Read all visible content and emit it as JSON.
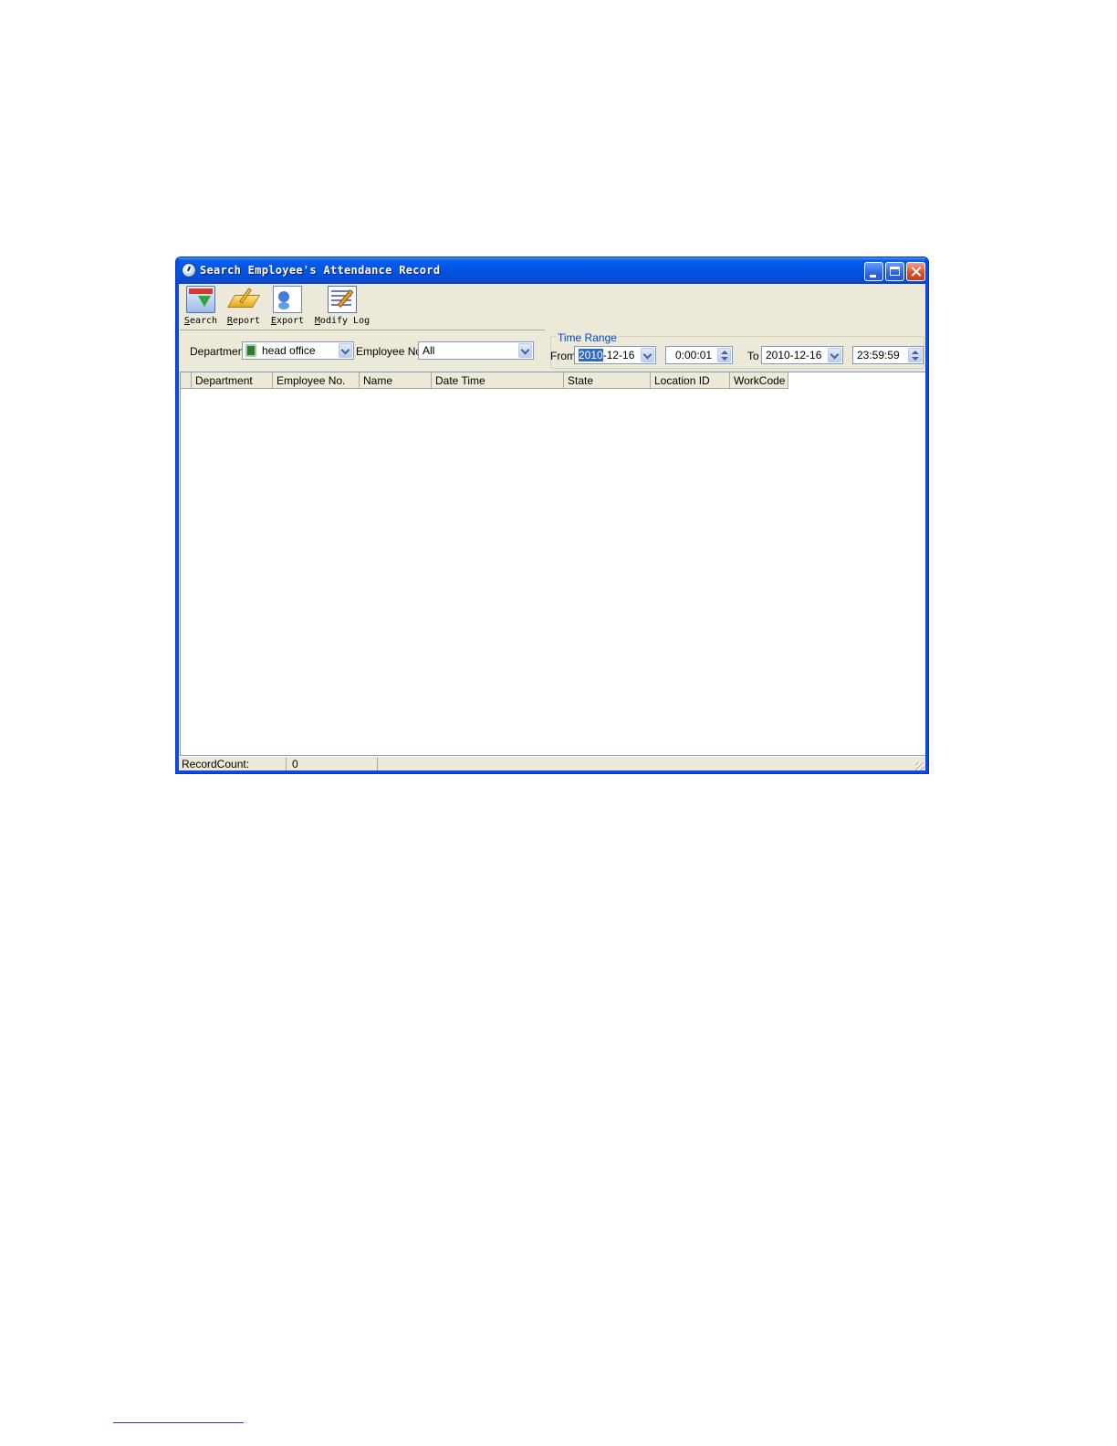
{
  "window": {
    "title": "Search Employee's Attendance Record"
  },
  "toolbar": {
    "search_label": "Search",
    "report_label": "Report",
    "export_label": "Export",
    "modify_log_label": "Modify Log"
  },
  "filters": {
    "department_label": "Department",
    "department_value": "head office",
    "employee_no_label": "Employee No.",
    "employee_no_value": "All"
  },
  "time_range": {
    "legend": "Time Range",
    "from_label": "From",
    "from_date_selected": "2010",
    "from_date_rest": "-12-16",
    "from_time": "0:00:01",
    "to_label": "To",
    "to_date": "2010-12-16",
    "to_time": "23:59:59"
  },
  "grid": {
    "columns": [
      "Department",
      "Employee No.",
      "Name",
      "Date Time",
      "State",
      "Location ID",
      "WorkCode"
    ],
    "rows": []
  },
  "status": {
    "record_count_label": "RecordCount:",
    "record_count_value": "0"
  },
  "colors": {
    "title_bar": "#0054e3",
    "window_face": "#ece9d8",
    "legend_text": "#0046d5",
    "selection": "#316ac5"
  },
  "icons": [
    "app-clock-icon",
    "search-icon",
    "report-icon",
    "export-icon",
    "modify-log-icon",
    "department-tree-icon",
    "chevron-down-icon",
    "spin-up-icon",
    "spin-down-icon"
  ]
}
